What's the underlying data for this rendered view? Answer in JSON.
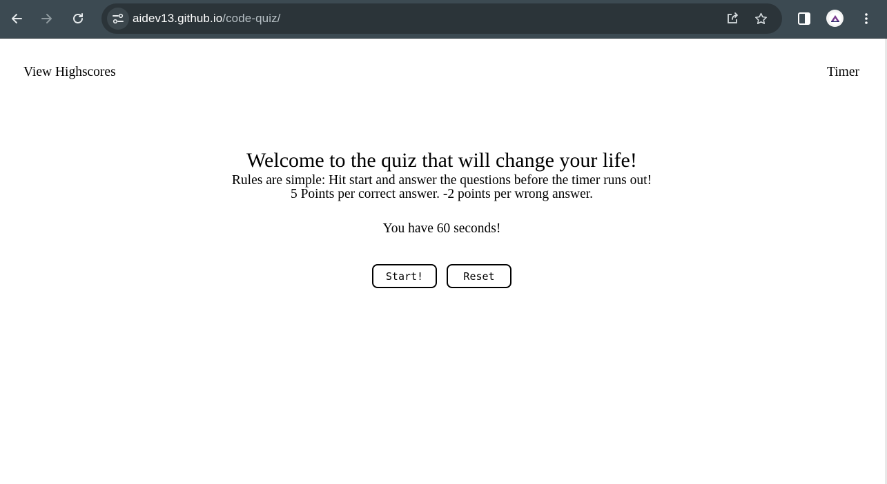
{
  "browser": {
    "url_host": "aidev13.github.io",
    "url_path": "/code-quiz/",
    "icons": [
      "back-icon",
      "forward-icon",
      "reload-icon",
      "site-info-icon",
      "share-icon",
      "bookmark-star-icon",
      "side-panel-icon",
      "profile-avatar",
      "more-menu-icon"
    ]
  },
  "header": {
    "highscores_label": "View Highscores",
    "timer_label": "Timer"
  },
  "main": {
    "title": "Welcome to the quiz that will change your life!",
    "rules_line1": "Rules are simple: Hit start and answer the questions before the timer runs out!",
    "rules_line2": "5 Points per correct answer. -2 points per wrong answer.",
    "time_notice": "You have 60 seconds!",
    "start_label": "Start!",
    "reset_label": "Reset"
  },
  "colors": {
    "toolbar": "#3c4a52",
    "omnibox": "#2b3439",
    "page_background": "#ffffff",
    "text": "#000000"
  }
}
